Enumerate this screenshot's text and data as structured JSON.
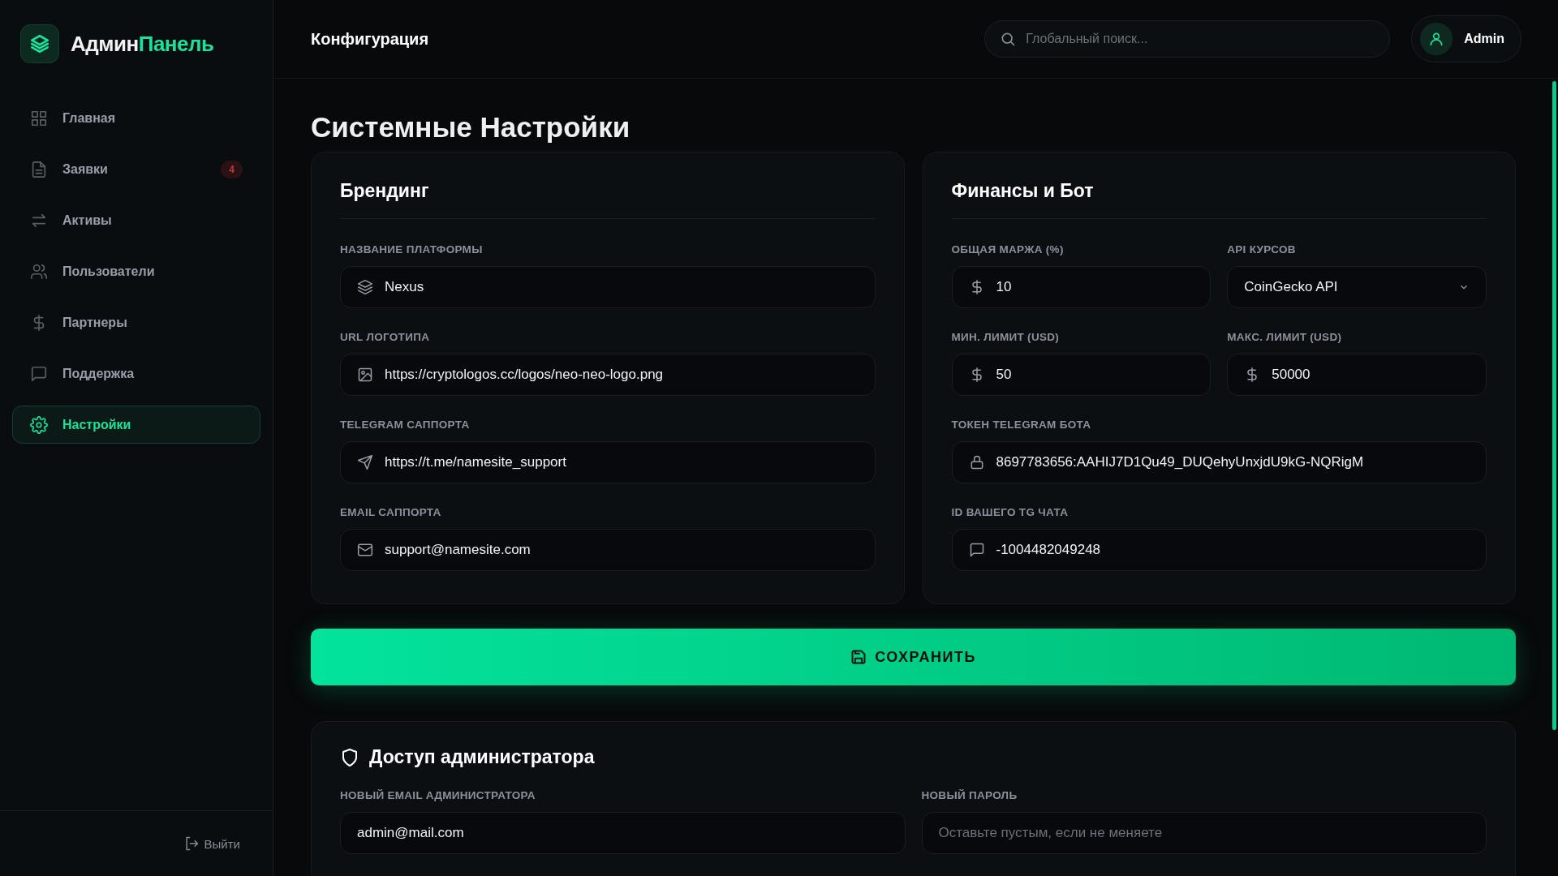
{
  "sidebar": {
    "logo": {
      "first": "Админ",
      "second": "Панель"
    },
    "items": [
      {
        "label": "Главная",
        "selected": false
      },
      {
        "label": "Заявки",
        "selected": false,
        "badge": "4"
      },
      {
        "label": "Активы",
        "selected": false
      },
      {
        "label": "Пользователи",
        "selected": false
      },
      {
        "label": "Партнеры",
        "selected": false
      },
      {
        "label": "Поддержка",
        "selected": false
      },
      {
        "label": "Настройки",
        "selected": true
      }
    ],
    "logout": "Выйти"
  },
  "header": {
    "title": "Конфигурация",
    "search": {
      "placeholder": "Глобальный поиск..."
    },
    "user": "Admin"
  },
  "page_title": "Системные Настройки",
  "cards": [
    {
      "title": "Брендинг",
      "rows": [
        [
          {
            "label": "НАЗВАНИЕ ПЛАТФОРМЫ",
            "kind": "input",
            "value": "Nexus"
          }
        ],
        [
          {
            "label": "URL ЛОГОТИПА",
            "kind": "input",
            "value": "https://cryptologos.cc/logos/neo-neo-logo.png"
          }
        ],
        [
          {
            "label": "TELEGRAM САППОРТА",
            "kind": "input",
            "value": "https://t.me/namesite_support"
          }
        ],
        [
          {
            "label": "EMAIL САППОРТА",
            "kind": "input",
            "value": "support@namesite.com"
          }
        ]
      ]
    },
    {
      "title": "Финансы и Бот",
      "rows": [
        [
          {
            "label": "ОБЩАЯ МАРЖА (%)",
            "kind": "input",
            "value": "10"
          },
          {
            "label": "API КУРСОВ",
            "kind": "select",
            "value": "CoinGecko API"
          }
        ],
        [
          {
            "label": "МИН. ЛИМИТ (USD)",
            "kind": "input",
            "value": "50"
          },
          {
            "label": "МАКС. ЛИМИТ (USD)",
            "kind": "input",
            "value": "50000"
          }
        ],
        [
          {
            "label": "ТОКЕН TELEGRAM БОТА",
            "kind": "input",
            "value": "8697783656:AAHIJ7D1Qu49_DUQehyUnxjdU9kG-NQRigM"
          }
        ],
        [
          {
            "label": "ID ВАШЕГО TG ЧАТА",
            "kind": "input",
            "value": "-1004482049248"
          }
        ]
      ]
    }
  ],
  "save_button": "СОХРАНИТЬ",
  "admin_card": {
    "title": "Доступ администратора",
    "fields": [
      {
        "label": "НОВЫЙ EMAIL АДМИНИСТРАТОРА",
        "kind": "input",
        "value": "admin@mail.com"
      },
      {
        "label": "НОВЫЙ ПАРОЛЬ",
        "kind": "input",
        "placeholder": "Оставьте пустым, если не меняете"
      }
    ]
  }
}
